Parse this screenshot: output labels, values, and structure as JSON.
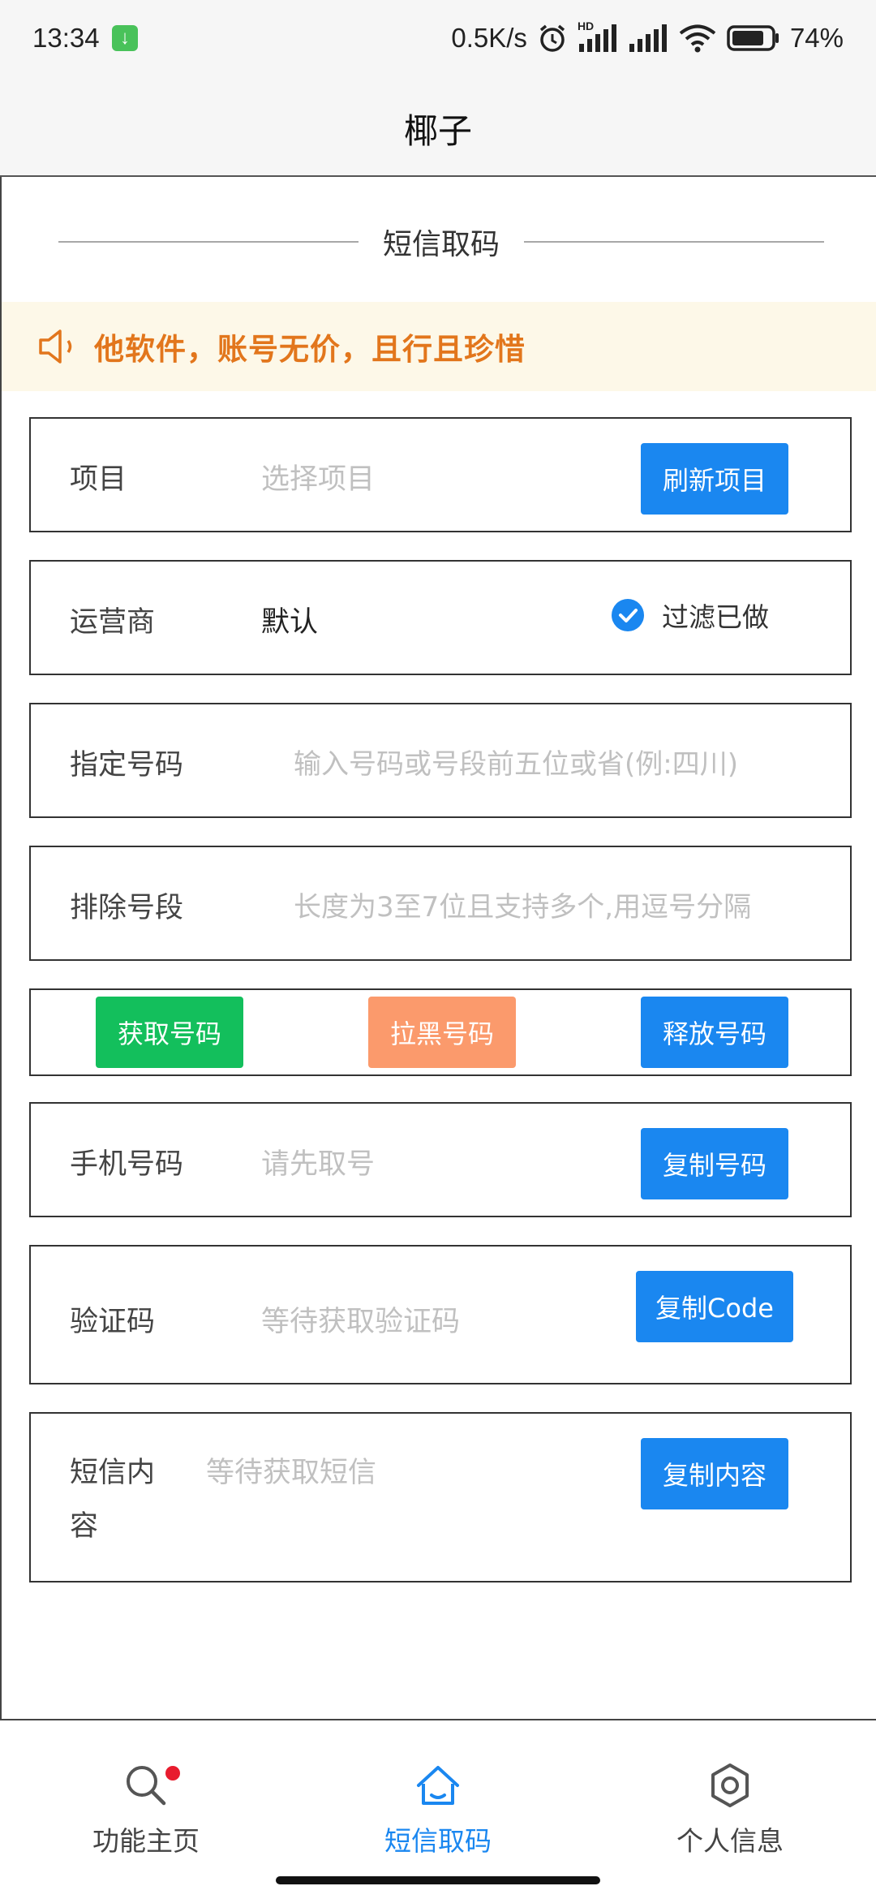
{
  "status_bar": {
    "time": "13:34",
    "download_icon": "download-arrow-icon",
    "net_speed": "0.5K/s",
    "hd_label": "HD",
    "battery_percent": "74%"
  },
  "header": {
    "title": "椰子"
  },
  "section": {
    "title": "短信取码"
  },
  "notice": {
    "icon": "speaker-icon",
    "text": "他软件，账号无价，且行且珍惜"
  },
  "form": {
    "project": {
      "label": "项目",
      "placeholder": "选择项目",
      "button": "刷新项目"
    },
    "carrier": {
      "label": "运营商",
      "value": "默认",
      "filter_label": "过滤已做",
      "filter_checked": true
    },
    "specify_number": {
      "label": "指定号码",
      "placeholder": "输入号码或号段前五位或省(例:四川)"
    },
    "exclude_segment": {
      "label": "排除号段",
      "placeholder": "长度为3至7位且支持多个,用逗号分隔"
    },
    "actions": {
      "get": "获取号码",
      "blacklist": "拉黑号码",
      "release": "释放号码"
    },
    "phone": {
      "label": "手机号码",
      "placeholder": "请先取号",
      "button": "复制号码"
    },
    "code": {
      "label": "验证码",
      "placeholder": "等待获取验证码",
      "button": "复制Code"
    },
    "sms": {
      "label_line1": "短信内",
      "label_line2": "容",
      "placeholder": "等待获取短信",
      "button": "复制内容"
    }
  },
  "bottom_nav": {
    "items": [
      {
        "label": "功能主页",
        "icon": "search-icon",
        "badge": true
      },
      {
        "label": "短信取码",
        "icon": "home-icon",
        "active": true
      },
      {
        "label": "个人信息",
        "icon": "gear-icon"
      }
    ]
  },
  "colors": {
    "primary": "#1a87f0",
    "success": "#13bf5c",
    "warning": "#fb9a6c",
    "notice_text": "#e2761c",
    "notice_bg": "#fdf8e8",
    "badge": "#e81c2e"
  }
}
